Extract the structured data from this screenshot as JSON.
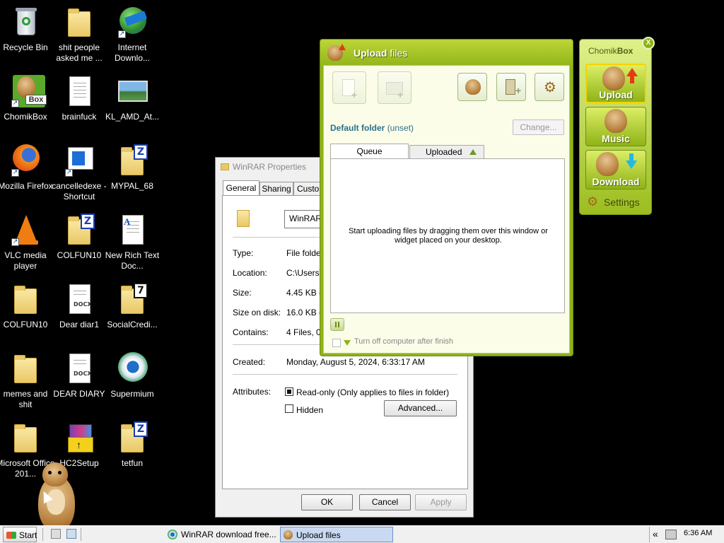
{
  "desktop_icons": [
    {
      "label": "Recycle Bin"
    },
    {
      "label": "shit people asked me ..."
    },
    {
      "label": "Internet Downlo..."
    },
    {
      "label": "ChomikBox"
    },
    {
      "label": "brainfuck"
    },
    {
      "label": "KL_AMD_At..."
    },
    {
      "label": "Mozilla Firefox"
    },
    {
      "label": "cancelledexe - Shortcut"
    },
    {
      "label": "MYPAL_68"
    },
    {
      "label": "VLC media player"
    },
    {
      "label": "COLFUN10"
    },
    {
      "label": "New Rich Text Doc..."
    },
    {
      "label": "COLFUN10"
    },
    {
      "label": "Dear diar1"
    },
    {
      "label": "SocialCredi..."
    },
    {
      "label": "memes and shit"
    },
    {
      "label": "DEAR DIARY"
    },
    {
      "label": "Supermium"
    },
    {
      "label": "Microsoft Office 201..."
    },
    {
      "label": "HC2Setup"
    },
    {
      "label": "tetfun"
    }
  ],
  "icon_glyphs": {
    "docx": "DOCX",
    "zip_letter": "Z",
    "seven_letter": "7",
    "box": "Box"
  },
  "properties": {
    "title": "WinRAR Properties",
    "tabs": [
      "General",
      "Sharing",
      "Custo"
    ],
    "name_value": "WinRAR",
    "rows": [
      {
        "label": "Type:",
        "value": "File folder"
      },
      {
        "label": "Location:",
        "value": "C:\\Users\\"
      },
      {
        "label": "Size:",
        "value": "4.45 KB (4"
      },
      {
        "label": "Size on disk:",
        "value": "16.0 KB (1"
      },
      {
        "label": "Contains:",
        "value": "4 Files, 0"
      }
    ],
    "created_label": "Created:",
    "created_value": "Monday, August 5, 2024, 6:33:17 AM",
    "attributes_label": "Attributes:",
    "readonly_label": "Read-only (Only applies to files in folder)",
    "hidden_label": "Hidden",
    "advanced_button": "Advanced...",
    "ok_button": "OK",
    "cancel_button": "Cancel",
    "apply_button": "Apply"
  },
  "upload": {
    "title_bold": "Upload",
    "title_rest": " files",
    "default_folder_label": "Default folder",
    "default_folder_value": "(unset)",
    "change_button": "Change...",
    "tab_queue": "Queue",
    "tab_uploaded": "Uploaded",
    "drop_message": "Start uploading files by dragging them over this window or widget placed on your desktop.",
    "shutdown_label": "Turn off computer after finish"
  },
  "widget": {
    "title_a": "Chomik",
    "title_b": "Box",
    "close_glyph": "X",
    "upload_label": "Upload",
    "music_label": "Music",
    "download_label": "Download",
    "settings_label": "Settings"
  },
  "taskbar": {
    "start_label": "Start",
    "tasks": [
      {
        "label": "WinRAR download free..."
      },
      {
        "label": "Upload files"
      }
    ],
    "tray_arrow": "«",
    "clock": "6:36 AM"
  },
  "colors": {
    "accent_green": "#8fb317",
    "chomik_border": "#7a9a18",
    "taskbar_active": "#c9d9f2",
    "desktop_bg": "#000000"
  }
}
